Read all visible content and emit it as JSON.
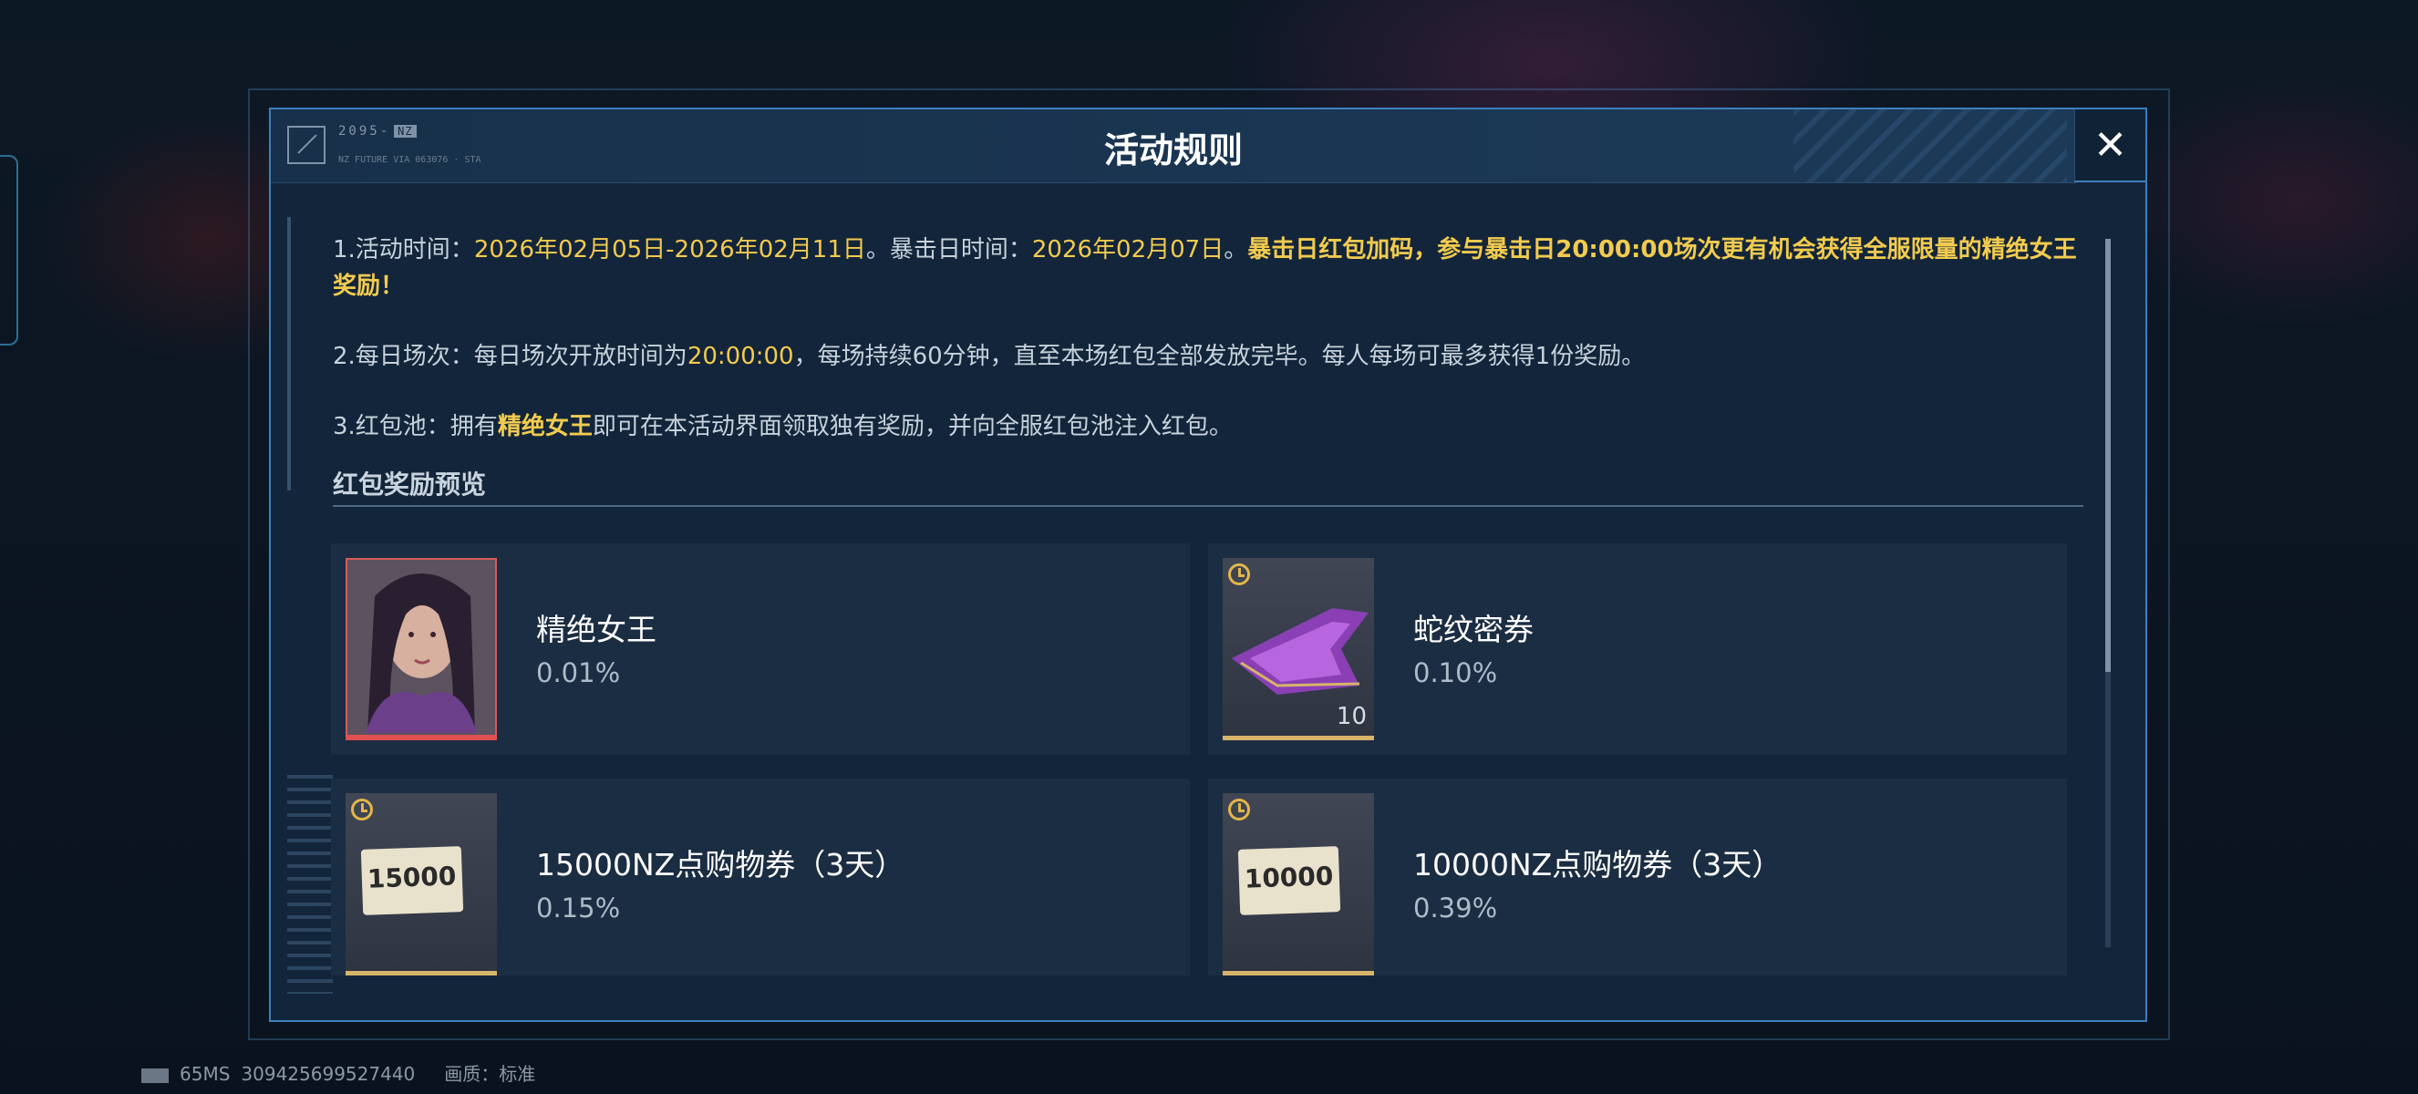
{
  "modal": {
    "title": "活动规则",
    "logo_text": "2095-",
    "logo_badge": "NZ",
    "logo_sub": "NZ FUTURE VIA 063076 · STA"
  },
  "rules": {
    "r1_prefix": "1.活动时间：",
    "r1_event_dates": "2026年02月05日-2026年02月11日",
    "r1_mid": "。暴击日时间：",
    "r1_crit_date": "2026年02月07日",
    "r1_dot": "。",
    "r1_highlight": "暴击日红包加码，参与暴击日20:00:00场次更有机会获得全服限量的精绝女王奖励！",
    "r2_prefix": "2.每日场次：每日场次开放时间为",
    "r2_time": "20:00:00",
    "r2_suffix": "，每场持续60分钟，直至本场红包全部发放完毕。每人每场可最多获得1份奖励。",
    "r3_prefix": "3.红包池：拥有",
    "r3_highlight": "精绝女王",
    "r3_suffix": "即可在本活动界面领取独有奖励，并向全服红包池注入红包。"
  },
  "section_title": "红包奖励预览",
  "rewards": [
    {
      "name": "精绝女王",
      "rate": "0.01%"
    },
    {
      "name": "蛇纹密券",
      "rate": "0.10%",
      "count": "10"
    },
    {
      "name": "15000NZ点购物券（3天）",
      "rate": "0.15%",
      "voucher": "15000"
    },
    {
      "name": "10000NZ点购物券（3天）",
      "rate": "0.39%",
      "voucher": "10000"
    }
  ],
  "status_bar": {
    "latency": "65MS",
    "id": "309425699527440",
    "quality_label": "画质：",
    "quality_value": "标准"
  },
  "colors": {
    "highlight": "#f2cb4f",
    "modal_bg": "#13253a",
    "border_accent": "#3d7fc0"
  }
}
